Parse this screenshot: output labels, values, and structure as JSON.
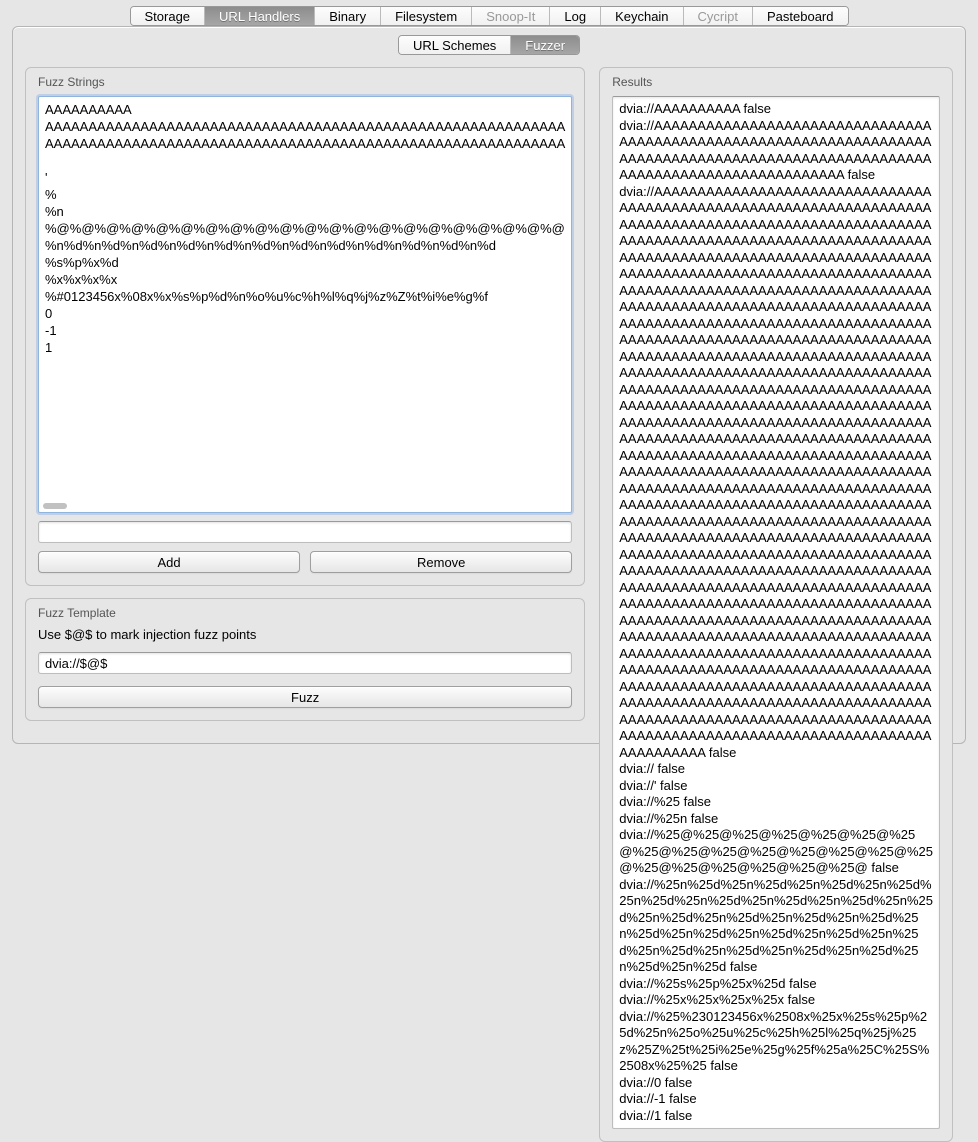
{
  "tabs": {
    "main": [
      {
        "label": "Storage",
        "active": false,
        "disabled": false
      },
      {
        "label": "URL Handlers",
        "active": true,
        "disabled": false
      },
      {
        "label": "Binary",
        "active": false,
        "disabled": false
      },
      {
        "label": "Filesystem",
        "active": false,
        "disabled": false
      },
      {
        "label": "Snoop-It",
        "active": false,
        "disabled": true
      },
      {
        "label": "Log",
        "active": false,
        "disabled": false
      },
      {
        "label": "Keychain",
        "active": false,
        "disabled": false
      },
      {
        "label": "Cycript",
        "active": false,
        "disabled": true
      },
      {
        "label": "Pasteboard",
        "active": false,
        "disabled": false
      }
    ],
    "sub": [
      {
        "label": "URL Schemes",
        "active": false
      },
      {
        "label": "Fuzzer",
        "active": true
      }
    ]
  },
  "fuzz_strings": {
    "title": "Fuzz Strings",
    "lines": [
      "AAAAAAAAAA",
      "AAAAAAAAAAAAAAAAAAAAAAAAAAAAAAAAAAAAAAAAAAAAAAAAAAAAAAAAAAAA",
      "AAAAAAAAAAAAAAAAAAAAAAAAAAAAAAAAAAAAAAAAAAAAAAAAAAAAAAAAAAAA",
      "",
      "'",
      "%",
      "%n",
      "%@%@%@%@%@%@%@%@%@%@%@%@%@%@%@%@%@%@%@%@%@",
      "%n%d%n%d%n%d%n%d%n%d%n%d%n%d%n%d%n%d%n%d%n%d%n%d",
      "%s%p%x%d",
      "%x%x%x%x",
      "%#0123456x%08x%x%s%p%d%n%o%u%c%h%l%q%j%z%Z%t%i%e%g%f",
      "0",
      "-1",
      "1"
    ],
    "input_value": "",
    "add_label": "Add",
    "remove_label": "Remove"
  },
  "fuzz_template": {
    "title": "Fuzz Template",
    "hint": "Use $@$ to mark injection fuzz points",
    "value": "dvia://$@$",
    "fuzz_label": "Fuzz"
  },
  "results": {
    "title": "Results",
    "lines": [
      "dvia://AAAAAAAAAA false",
      "dvia://AAAAAAAAAAAAAAAAAAAAAAAAAAAAAAAAAAAAAAAAAAAAAAAAAAAAAAAAAAAAAAAAAAAAAAAAAAAAAAAAAAAAAAAAAAAAAAAAAAAAAAAAAAAAAAAAAAAAAAAAAAAAAAAAAA false",
      "dvia://AAAAAAAAAAAAAAAAAAAAAAAAAAAAAAAAAAAAAAAAAAAAAAAAAAAAAAAAAAAAAAAAAAAAAAAAAAAAAAAAAAAAAAAAAAAAAAAAAAAAAAAAAAAAAAAAAAAAAAAAAAAAAAAAAAAAAAAAAAAAAAAAAAAAAAAAAAAAAAAAAAAAAAAAAAAAAAAAAAAAAAAAAAAAAAAAAAAAAAAAAAAAAAAAAAAAAAAAAAAAAAAAAAAAAAAAAAAAAAAAAAAAAAAAAAAAAAAAAAAAAAAAAAAAAAAAAAAAAAAAAAAAAAAAAAAAAAAAAAAAAAAAAAAAAAAAAAAAAAAAAAAAAAAAAAAAAAAAAAAAAAAAAAAAAAAAAAAAAAAAAAAAAAAAAAAAAAAAAAAAAAAAAAAAAAAAAAAAAAAAAAAAAAAAAAAAAAAAAAAAAAAAAAAAAAAAAAAAAAAAAAAAAAAAAAAAAAAAAAAAAAAAAAAAAAAAAAAAAAAAAAAAAAAAAAAAAAAAAAAAAAAAAAAAAAAAAAAAAAAAAAAAAAAAAAAAAAAAAAAAAAAAAAAAAAAAAAAAAAAAAAAAAAAAAAAAAAAAAAAAAAAAAAAAAAAAAAAAAAAAAAAAAAAAAAAAAAAAAAAAAAAAAAAAAAAAAAAAAAAAAAAAAAAAAAAAAAAAAAAAAAAAAAAAAAAAAAAAAAAAAAAAAAAAAAAAAAAAAAAAAAAAAAAAAAAAAAAAAAAAAAAAAAAAAAAAAAAAAAAAAAAAAAAAAAAAAAAAAAAAAAAAAAAAAAAAAAAAAAAAAAAAAAAAAAAAAAAAAAAAAAAAAAAAAAAAAAAAAAAAAAAAAAAAAAAAAAAAAAAAAAAAAAAAAAAAAAAAAAAAAAAAAAAAAAAAAAAAAAAAAAAAAAAAAAAAAAAAAAAAAAAAAAAAAAAAAAAAAAAAAAAAAAAAAAAAAAAAAAAAAAAAAAAAAAAAAAAAAAAAAAAAAAAAAAAAAAAAAAAAAAAAAAAAAAAAAAAAAAAAAAAAAAAAAAAAAAAAAAAAAAAAAAAAAAAAAAAAAAAAAAAAAAAAAAAAAAAAAAAAAAAAAAAAAAAAAAAAAAAAAAAAAAAAAAAAAAAAAAAAAAAAAAAAAAAAAAAAAAAAAAAAAAAAAAAAAAAAAAAAAAAAAAAAAAAAAAAAAAAAAAAAAAAAAAAAAAAAAAAAAAAAAAAAAAAAAAAAAAAAAAAAAAAAAAAAAAAAAAAAAAAAAAAAAA false",
      "dvia:// false",
      "dvia://' false",
      "dvia://%25 false",
      "dvia://%25n false",
      "dvia://%25@%25@%25@%25@%25@%25@%25@%25@%25@%25@%25@%25@%25@%25@%25@%25@%25@%25@%25@%25@%25@ false",
      "dvia://%25n%25d%25n%25d%25n%25d%25n%25d%25n%25d%25n%25d%25n%25d%25n%25d%25n%25d%25n%25d%25n%25d%25n%25d%25n%25d%25n%25d%25n%25d%25n%25d%25n%25d%25n%25d%25n%25d%25n%25d%25n%25d%25n%25d%25n%25d%25n%25d false",
      "dvia://%25s%25p%25x%25d false",
      "dvia://%25x%25x%25x%25x false",
      "dvia://%25%230123456x%2508x%25x%25s%25p%25d%25n%25o%25u%25c%25h%25l%25q%25j%25z%25Z%25t%25i%25e%25g%25f%25a%25C%25S%2508x%25%25 false",
      "dvia://0 false",
      "dvia://-1 false",
      "dvia://1 false"
    ]
  }
}
